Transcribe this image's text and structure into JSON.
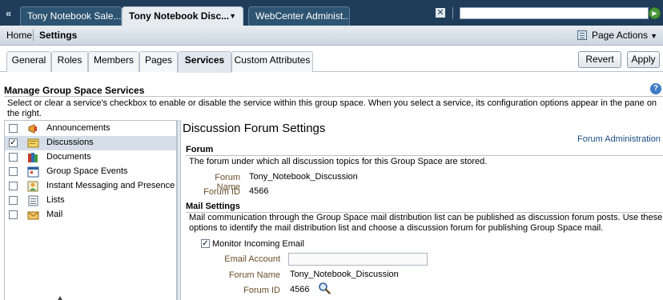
{
  "top_tabs": [
    {
      "label": "Tony Notebook Sale...",
      "state": "inactive"
    },
    {
      "label": "Tony Notebook Disc...",
      "state": "active"
    },
    {
      "label": "WebCenter Administ...",
      "state": "inactive"
    }
  ],
  "top_search": {
    "value": "",
    "placeholder": ""
  },
  "breadcrumb": {
    "home": "Home",
    "current": "Settings"
  },
  "page_actions_label": "Page Actions",
  "sub_tabs": [
    {
      "label": "General"
    },
    {
      "label": "Roles"
    },
    {
      "label": "Members"
    },
    {
      "label": "Pages"
    },
    {
      "label": "Services",
      "active": true
    },
    {
      "label": "Custom Attributes"
    }
  ],
  "buttons": {
    "revert": "Revert",
    "apply": "Apply"
  },
  "section": {
    "title": "Manage Group Space Services",
    "description": "Select or clear a service's checkbox to enable or disable the service within this group space. When you select a service, its configuration options appear in the pane on the right."
  },
  "services": [
    {
      "label": "Announcements",
      "checked": false,
      "selected": false,
      "icon": "megaphone-icon"
    },
    {
      "label": "Discussions",
      "checked": true,
      "selected": true,
      "icon": "discussion-icon"
    },
    {
      "label": "Documents",
      "checked": false,
      "selected": false,
      "icon": "books-icon"
    },
    {
      "label": "Group Space Events",
      "checked": false,
      "selected": false,
      "icon": "calendar-icon"
    },
    {
      "label": "Instant Messaging and Presence",
      "checked": false,
      "selected": false,
      "icon": "presence-icon"
    },
    {
      "label": "Lists",
      "checked": false,
      "selected": false,
      "icon": "list-icon"
    },
    {
      "label": "Mail",
      "checked": false,
      "selected": false,
      "icon": "mail-icon"
    }
  ],
  "detail": {
    "title": "Discussion Forum Settings",
    "admin_link": "Forum Administration",
    "forum": {
      "heading": "Forum",
      "description": "The forum under which all discussion topics for this Group Space are stored.",
      "name_label": "Forum Name",
      "name_value": "Tony_Notebook_Discussion",
      "id_label": "Forum ID",
      "id_value": "4566"
    },
    "mail": {
      "heading": "Mail Settings",
      "description_line1": "Mail communication through the Group Space mail distribution list can be published as discussion forum posts. Use these",
      "description_line2": "options to identify the mail distribution list and choose a discussion forum for publishing Group Space mail.",
      "monitor_label": "Monitor Incoming Email",
      "monitor_checked": true,
      "email_label": "Email Account",
      "email_value": "",
      "name_label": "Forum Name",
      "name_value": "Tony_Notebook_Discussion",
      "id_label": "Forum ID",
      "id_value": "4566"
    }
  },
  "colors": {
    "header_bg": "#1f3d5a",
    "selected_row": "#d5dee8",
    "link": "#1c4f83",
    "field_label": "#6b4f2a"
  }
}
